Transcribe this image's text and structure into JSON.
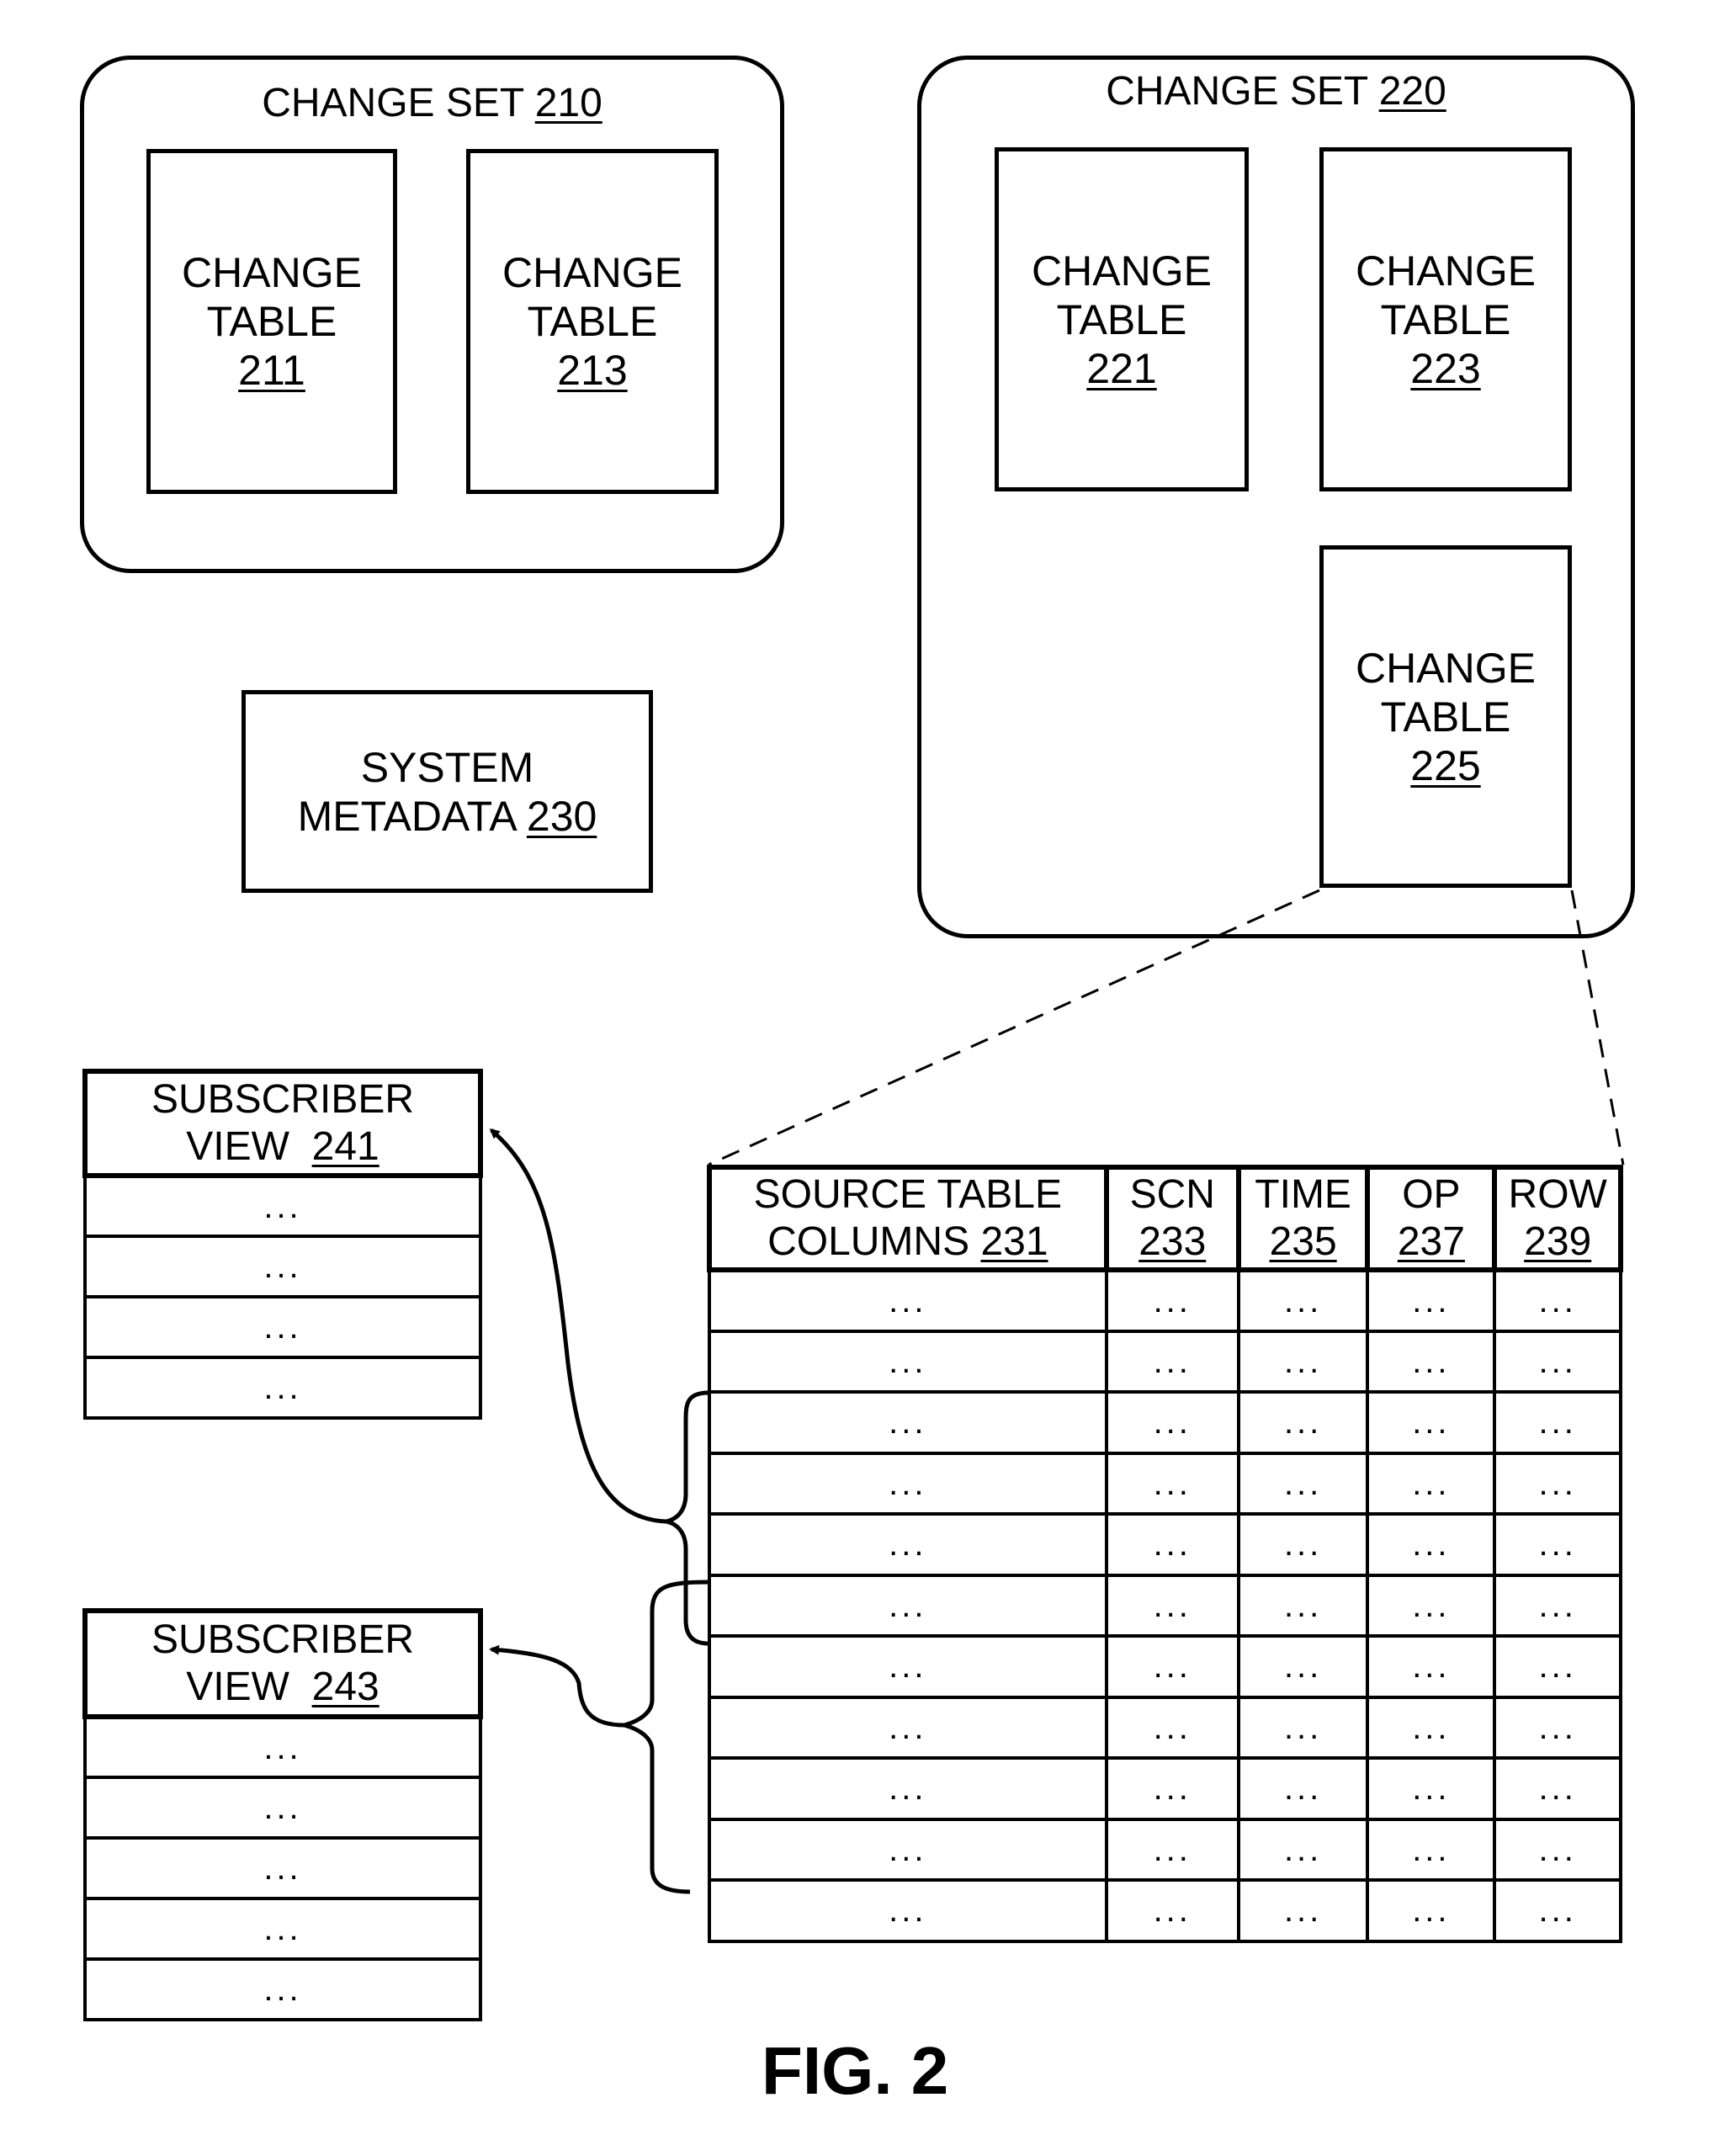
{
  "figure_label": "FIG. 2",
  "change_sets": [
    {
      "title": "CHANGE SET",
      "ref": "210",
      "tables": [
        {
          "line1": "CHANGE",
          "line2": "TABLE",
          "ref": "211"
        },
        {
          "line1": "CHANGE",
          "line2": "TABLE",
          "ref": "213"
        }
      ]
    },
    {
      "title": "CHANGE SET",
      "ref": "220",
      "tables": [
        {
          "line1": "CHANGE",
          "line2": "TABLE",
          "ref": "221"
        },
        {
          "line1": "CHANGE",
          "line2": "TABLE",
          "ref": "223"
        },
        {
          "line1": "CHANGE",
          "line2": "TABLE",
          "ref": "225"
        }
      ]
    }
  ],
  "system_metadata": {
    "line1": "SYSTEM",
    "line2": "METADATA",
    "ref": "230"
  },
  "change_table_detail": {
    "columns": [
      {
        "line1": "SOURCE TABLE",
        "line2": "COLUMNS",
        "ref": "231"
      },
      {
        "line1": "SCN",
        "line2": "",
        "ref": "233"
      },
      {
        "line1": "TIME",
        "line2": "",
        "ref": "235"
      },
      {
        "line1": "OP",
        "line2": "",
        "ref": "237"
      },
      {
        "line1": "ROW",
        "line2": "",
        "ref": "239"
      }
    ],
    "row_count": 11,
    "cell_text": "..."
  },
  "subscriber_views": [
    {
      "line1": "SUBSCRIBER",
      "line2": "VIEW",
      "ref": "241",
      "row_count": 4,
      "cell_text": "..."
    },
    {
      "line1": "SUBSCRIBER",
      "line2": "VIEW",
      "ref": "243",
      "row_count": 5,
      "cell_text": "..."
    }
  ]
}
